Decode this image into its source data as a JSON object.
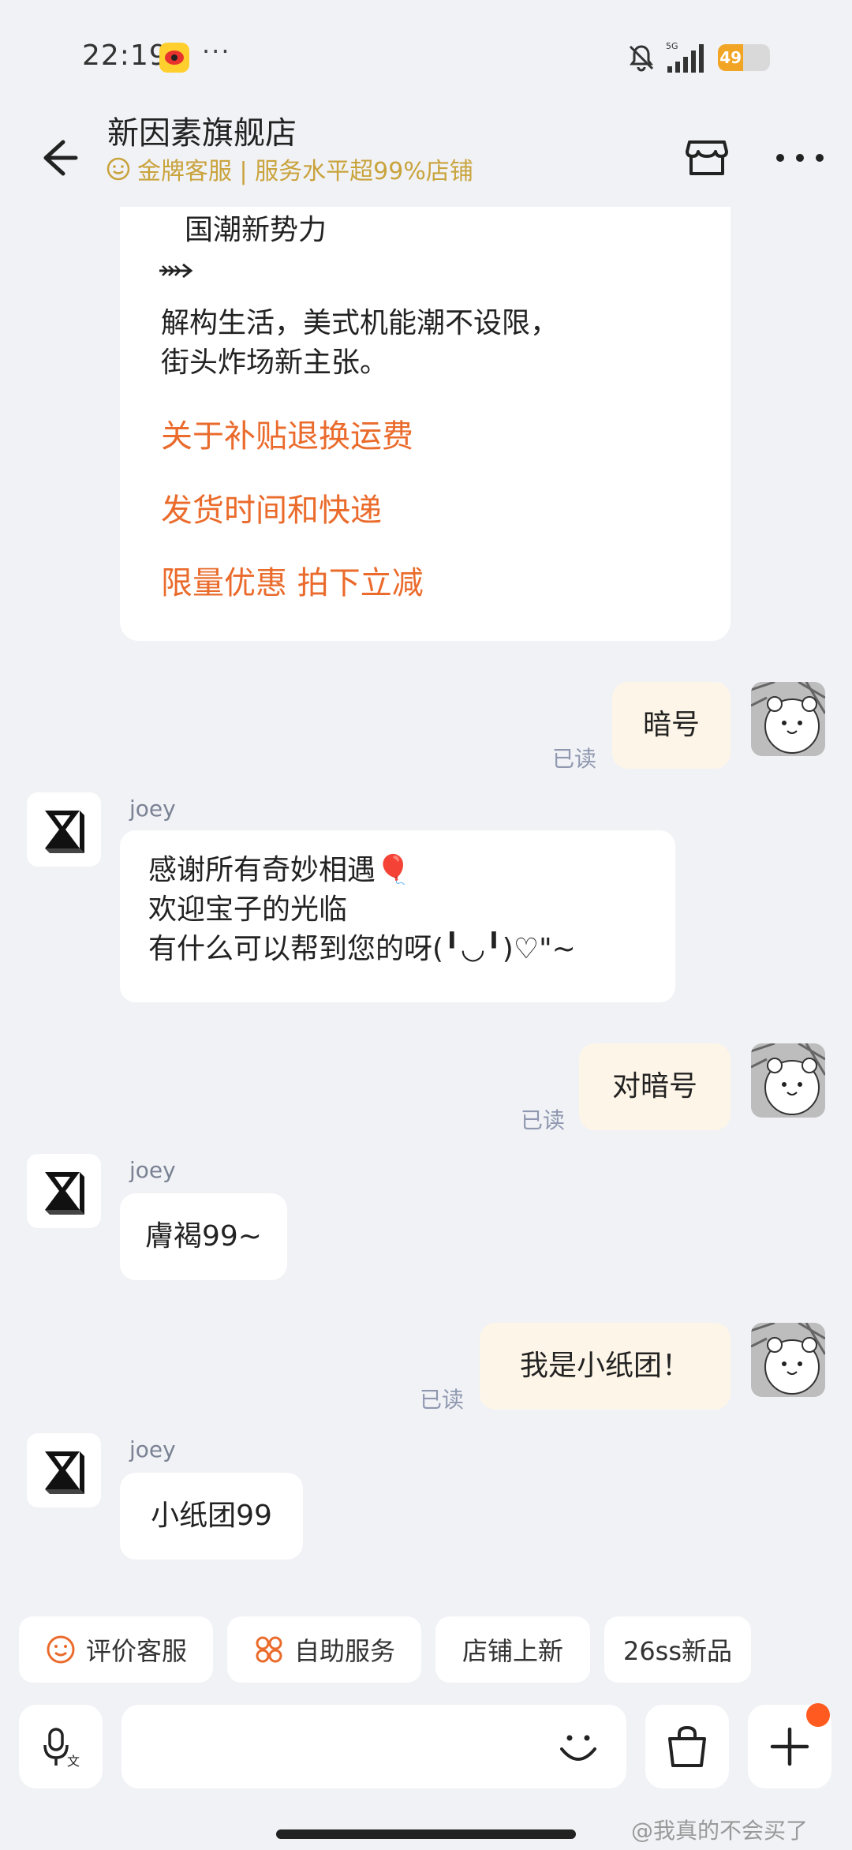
{
  "status_bar": {
    "time": "22:19",
    "dots": "···",
    "battery_level": "49",
    "battery_fraction": 0.49
  },
  "header": {
    "title": "新因素旗舰店",
    "service_badge": "金牌客服 | 服务水平超99%店铺"
  },
  "intro_card": {
    "lines": [
      "国潮新势力",
      "解构生活，美式机能潮不设限，",
      "街头炸场新主张。"
    ],
    "links": [
      "关于补贴退换运费",
      "发货时间和快递",
      "限量优惠 拍下立减"
    ]
  },
  "messages": [
    {
      "from": "me",
      "text": "暗号",
      "read": "已读"
    },
    {
      "from": "shop",
      "sender": "joey",
      "lines": [
        "感谢所有奇妙相遇🎈",
        " 欢迎宝子的光临",
        "有什么可以帮到您的呀(╹◡╹)♡\"~"
      ]
    },
    {
      "from": "me",
      "text": "对暗号",
      "read": "已读"
    },
    {
      "from": "shop",
      "sender": "joey",
      "text": "膚褐99~"
    },
    {
      "from": "me",
      "text": "我是小纸团！",
      "read": "已读"
    },
    {
      "from": "shop",
      "sender": "joey",
      "text": "小纸团99"
    }
  ],
  "quick_replies": [
    "评价客服",
    "自助服务",
    "店铺上新",
    "26ss新品"
  ],
  "input": {
    "placeholder": ""
  },
  "watermark": "@我真的不会买了",
  "colors": {
    "accent_orange": "#ea6b2c",
    "gold": "#c9a33c",
    "bg": "#f1f2f6",
    "my_bubble": "#fdf5e7"
  },
  "icons": [
    "weibo-icon",
    "mute-icon",
    "signal-icon",
    "back-arrow-icon",
    "store-icon",
    "more-icon",
    "smile-icon",
    "grid-icon",
    "mic-icon",
    "emoji-icon",
    "shopping-bag-icon",
    "plus-icon"
  ]
}
